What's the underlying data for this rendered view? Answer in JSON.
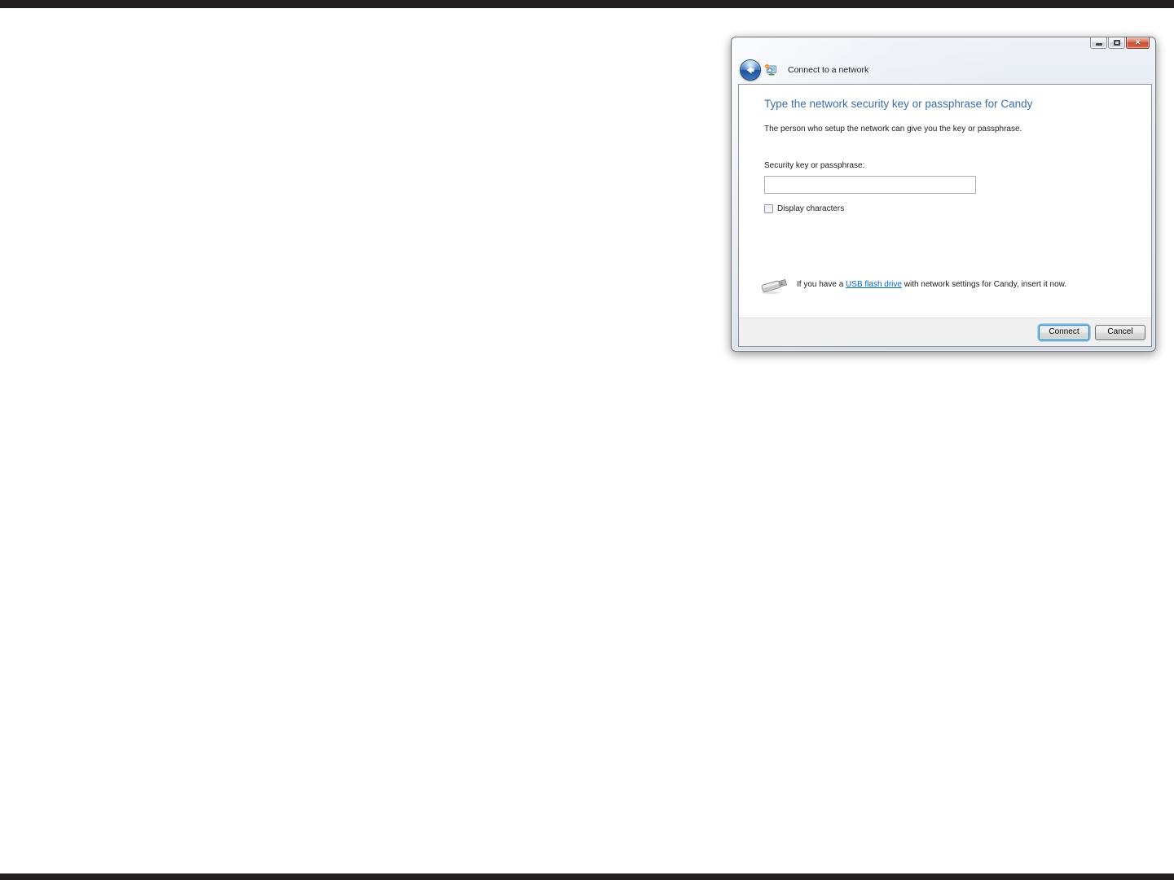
{
  "window": {
    "title": "Connect to a network",
    "heading": "Type the network security key or passphrase for Candy",
    "description": "The person who setup the network can give you the key or passphrase.",
    "security_key": {
      "label": "Security key or passphrase:",
      "value": ""
    },
    "display_characters": {
      "label": "Display characters",
      "checked": false
    },
    "usb_hint": {
      "prefix": "If you have a ",
      "link": "USB flash drive",
      "suffix": " with network settings for Candy, insert it now."
    },
    "buttons": {
      "connect": "Connect",
      "cancel": "Cancel"
    },
    "icons": {
      "back": "back-arrow-icon",
      "app": "network-wizard-icon",
      "usb": "usb-flash-drive-icon",
      "close_glyph": "✕"
    },
    "colors": {
      "heading_text": "#3c6ea5",
      "link_text": "#0066cc",
      "close_button": "#c84b33",
      "default_button_glow": "#7ab8dd"
    }
  }
}
